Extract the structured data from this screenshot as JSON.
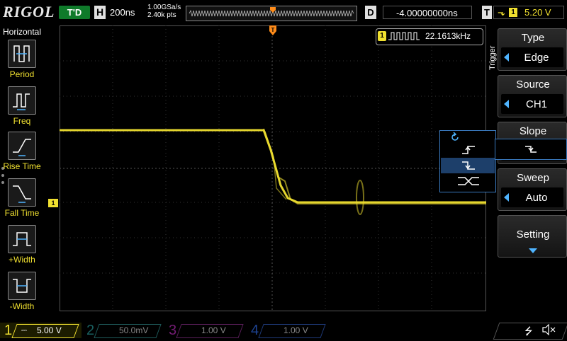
{
  "topbar": {
    "logo": "RIGOL",
    "run_state": "T'D",
    "h_label": "H",
    "timebase": "200ns",
    "sample_rate": "1.00GSa/s",
    "mem_depth": "2.40k pts",
    "d_label": "D",
    "delay": "-4.00000000ns",
    "t_label": "T",
    "trigger_channel": "1",
    "trigger_level": "5.20 V"
  },
  "left_panel": {
    "title": "Horizontal",
    "items": [
      {
        "label": "Period",
        "icon": "period-icon"
      },
      {
        "label": "Freq",
        "icon": "freq-icon"
      },
      {
        "label": "Rise Time",
        "icon": "rise-time-icon"
      },
      {
        "label": "Fall Time",
        "icon": "fall-time-icon"
      },
      {
        "label": "+Width",
        "icon": "pos-width-icon"
      },
      {
        "label": "-Width",
        "icon": "neg-width-icon"
      }
    ]
  },
  "frequency_counter": {
    "channel": "1",
    "value": "22.1613kHz"
  },
  "channel_marker": "1",
  "right_menu": {
    "side_label": "Trigger",
    "type": {
      "title": "Type",
      "value": "Edge"
    },
    "source": {
      "title": "Source",
      "value": "CH1"
    },
    "slope": {
      "title": "Slope"
    },
    "sweep": {
      "title": "Sweep",
      "value": "Auto"
    },
    "setting": {
      "title": "Setting"
    }
  },
  "bottom": {
    "channels": [
      {
        "num": "1",
        "value": "5.00 V",
        "color": "#f0e030",
        "active": true
      },
      {
        "num": "2",
        "value": "50.0mV",
        "color": "#2aa0a0",
        "active": false
      },
      {
        "num": "3",
        "value": "1.00 V",
        "color": "#c030c0",
        "active": false
      },
      {
        "num": "4",
        "value": "1.00 V",
        "color": "#2a60d0",
        "active": false
      }
    ]
  },
  "colors": {
    "ch1": "#f0e030",
    "accent": "#4fb4ff",
    "trigger_marker": "#ff8c1a"
  }
}
